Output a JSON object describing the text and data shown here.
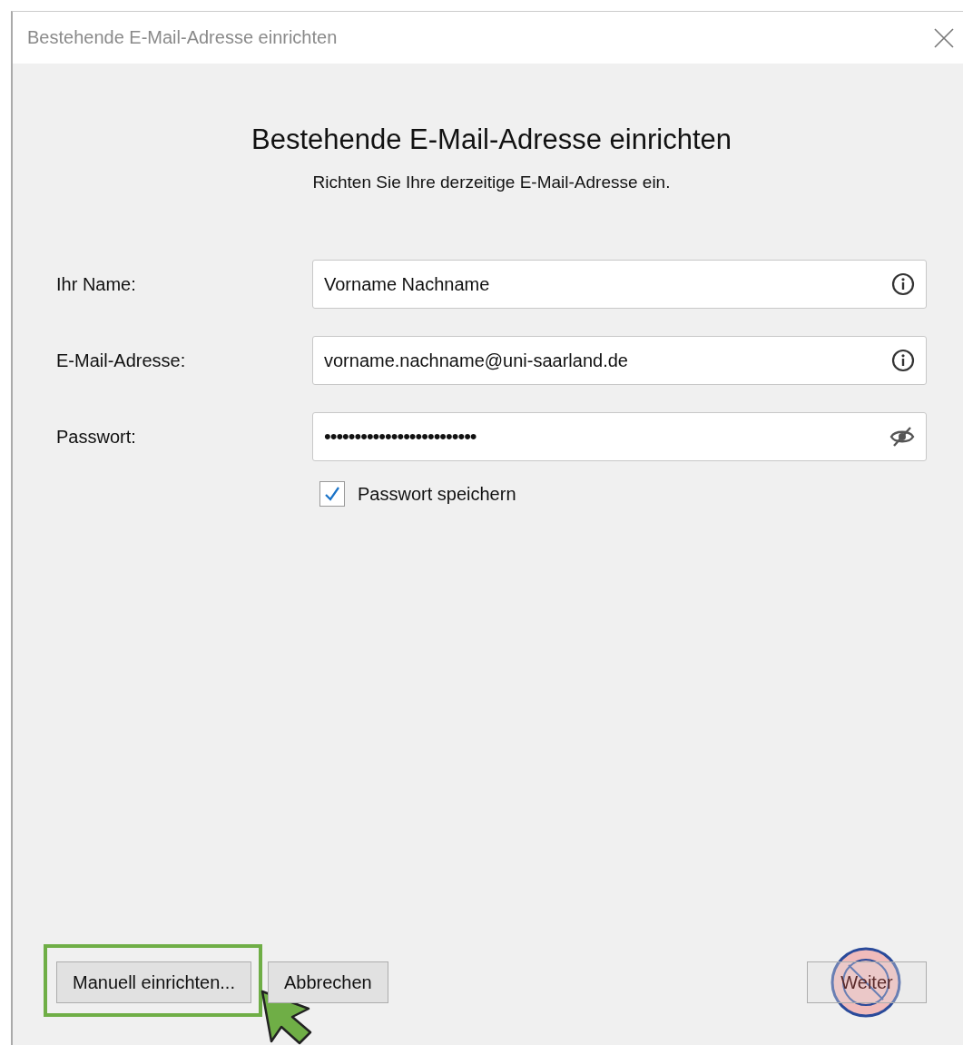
{
  "window": {
    "title": "Bestehende E-Mail-Adresse einrichten"
  },
  "heading": "Bestehende E-Mail-Adresse einrichten",
  "subtitle": "Richten Sie Ihre derzeitige E-Mail-Adresse ein.",
  "fields": [
    {
      "label": "Ihr Name:",
      "value": "Vorname Nachname",
      "kind": "info"
    },
    {
      "label": "E-Mail-Adresse:",
      "value": "vorname.nachname@uni-saarland.de",
      "kind": "info"
    },
    {
      "label": "Passwort:",
      "value": "•••••••••••••••••••••••••",
      "kind": "password"
    }
  ],
  "remember_password": {
    "label": "Passwort speichern",
    "checked": true
  },
  "buttons": [
    {
      "label": "Manuell einrichten...",
      "disabled": false,
      "highlighted": true,
      "forbidden": false
    },
    {
      "label": "Abbrechen",
      "disabled": false,
      "highlighted": false,
      "forbidden": false
    },
    {
      "label": "Weiter",
      "disabled": true,
      "highlighted": false,
      "forbidden": true
    }
  ]
}
